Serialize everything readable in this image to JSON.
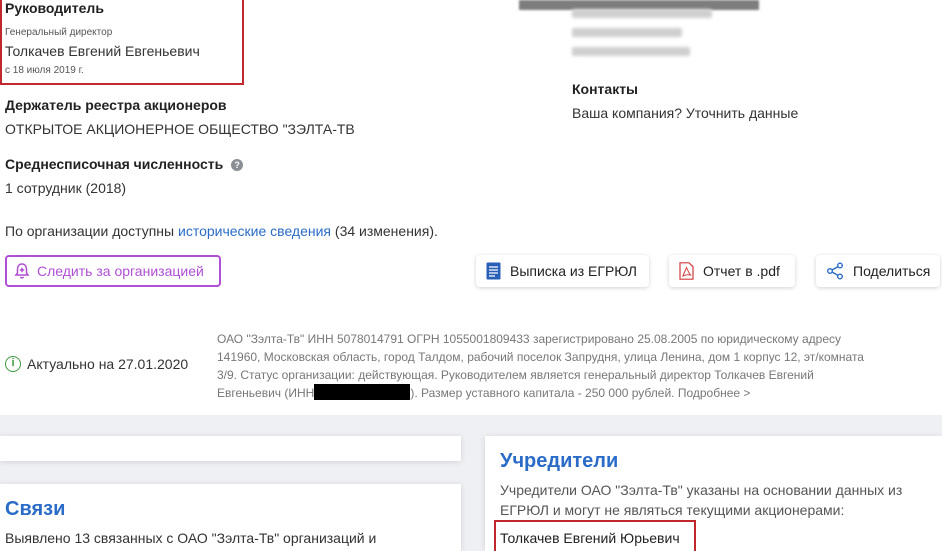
{
  "leader": {
    "heading": "Руководитель",
    "role": "Генеральный директор",
    "name": "Толкачев Евгений Евгеньевич",
    "since": "с 18 июля 2019 г."
  },
  "registry": {
    "heading": "Держатель реестра акционеров",
    "value": "ОТКРЫТОЕ АКЦИОНЕРНОЕ ОБЩЕСТВО \"ЗЭЛТА-ТВ"
  },
  "headcount": {
    "heading": "Среднесписочная численность",
    "value": "1 сотрудник (2018)"
  },
  "history": {
    "prefix": "По организации доступны ",
    "link": "исторические сведения",
    "suffix": " (34 изменения)."
  },
  "contacts": {
    "heading": "Контакты",
    "link": "Ваша компания? Уточнить данные"
  },
  "buttons": {
    "follow": "Следить за организацией",
    "egrul": "Выписка из ЕГРЮЛ",
    "pdf": "Отчет в .pdf",
    "share": "Поделиться"
  },
  "summary": {
    "actual": "Актуально на 27.01.2020",
    "line1": "ОАО \"Зэлта-Тв\" ИНН 5078014791 ОГРН 1055001809433 зарегистрировано 25.08.2005 по юридическому адресу",
    "line2": "141960, Московская область, город Талдом, рабочий поселок Запрудня, улица Ленина, дом 1 корпус 12, эт/комната",
    "line3": "3/9. Статус организации: действующая. Руководителем является генеральный директор Толкачев Евгений",
    "line4_pre": "Евгеньевич (ИНН",
    "line4_post": "). Размер уставного капитала - 250 000 рублей. Подробнее >"
  },
  "links_section": {
    "heading": "Связи",
    "text": "Выявлено 13 связанных с ОАО \"Зэлта-Тв\" организаций и"
  },
  "founders": {
    "heading": "Учредители",
    "text1": "Учредители ОАО \"Зэлта-Тв\" указаны на основании данных из",
    "text2": "ЕГРЮЛ и могут не являться текущими акционерами:",
    "name": "Толкачев Евгений Юрьевич"
  },
  "colors": {
    "link": "#2a6cc8",
    "accent_purple": "#b04fd6",
    "highlight_red": "#c0282d",
    "info_green": "#3b9a3b"
  }
}
